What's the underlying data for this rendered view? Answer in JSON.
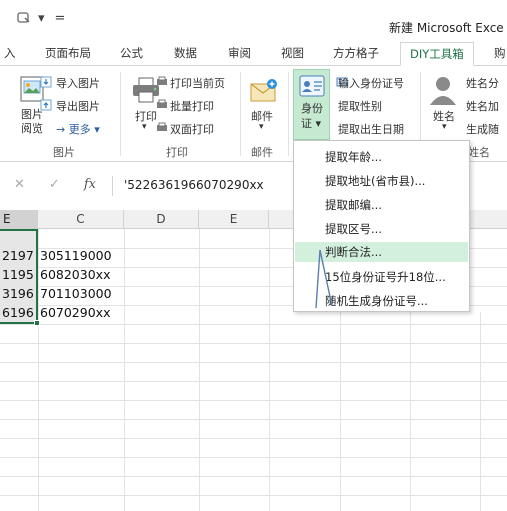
{
  "window": {
    "title": "新建 Microsoft Exce",
    "qat_dropdown": "▾",
    "qat_customize": "="
  },
  "tabs": [
    {
      "label": "入"
    },
    {
      "label": "页面布局"
    },
    {
      "label": "公式"
    },
    {
      "label": "数据"
    },
    {
      "label": "审阅"
    },
    {
      "label": "视图"
    },
    {
      "label": "方方格子"
    },
    {
      "label": "DIY工具箱"
    },
    {
      "label": "购"
    }
  ],
  "ribbon": {
    "groups": {
      "image": {
        "label": "图片",
        "big_button": {
          "line1": "图片",
          "line2": "阅览"
        },
        "items": [
          "导入图片",
          "导出图片",
          "→ 更多 ▾"
        ]
      },
      "print": {
        "label": "打印",
        "big_button": {
          "line1": "打印",
          "arrow": "▾"
        },
        "items": [
          "打印当前页",
          "批量打印",
          "双面打印"
        ]
      },
      "mail": {
        "label": "邮件",
        "big_button": {
          "line1": "邮件",
          "arrow": "▾"
        }
      },
      "idcard": {
        "big_button": {
          "line1": "身份",
          "line2": "证 ▾"
        },
        "items": [
          "输入身份证号",
          "提取性别",
          "提取出生日期"
        ]
      },
      "name": {
        "label": "姓名",
        "big_button": {
          "line1": "姓名",
          "arrow": "▾"
        },
        "items": [
          "姓名分",
          "姓名加",
          "生成随"
        ]
      }
    }
  },
  "formula_bar": {
    "cancel": "✕",
    "enter": "✓",
    "fx": "fx",
    "value": "'5226361966070290xx"
  },
  "grid": {
    "columns": [
      "E",
      "C",
      "D",
      "E"
    ],
    "rows": [
      {
        "b": "2197",
        "c": "305119000"
      },
      {
        "b": "1195",
        "c": "6082030xx"
      },
      {
        "b": "3196",
        "c": "701103000"
      },
      {
        "b": "6196",
        "c": "6070290xx"
      }
    ]
  },
  "menu": {
    "items": [
      {
        "label": "提取年龄..."
      },
      {
        "label": "提取地址(省市县)..."
      },
      {
        "label": "提取邮编..."
      },
      {
        "label": "提取区号..."
      },
      {
        "label": "判断合法..."
      },
      {
        "label": "15位身份证号升18位..."
      },
      {
        "label": "随机生成身份证号..."
      }
    ]
  },
  "colors": {
    "accent": "#217346",
    "menu_highlight": "#d3f0dd",
    "button_highlight": "#c6e9d2"
  }
}
